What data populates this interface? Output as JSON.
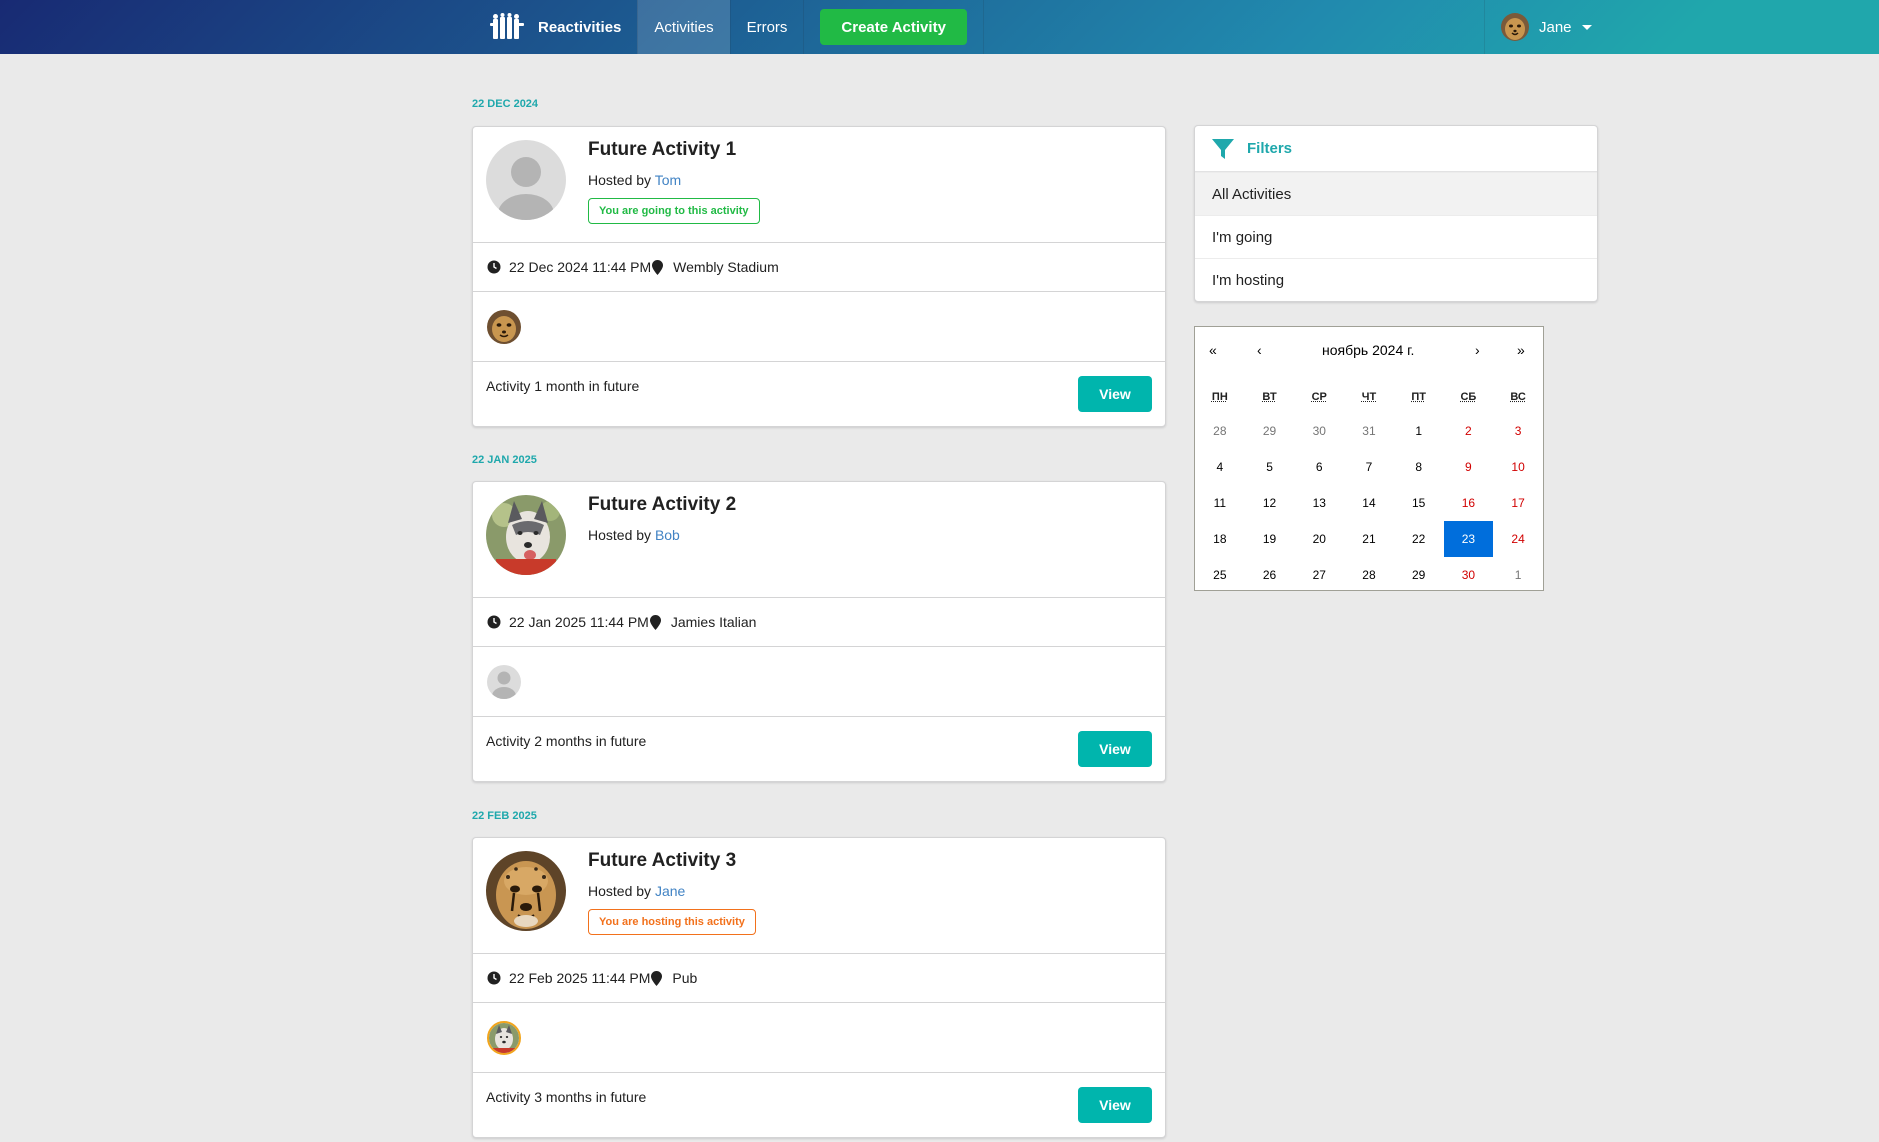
{
  "navbar": {
    "brand": "Reactivities",
    "activities": "Activities",
    "errors": "Errors",
    "create": "Create Activity",
    "user": "Jane"
  },
  "activities": [
    {
      "date_header": "22 DEC 2024",
      "title": "Future Activity 1",
      "hosted_prefix": "Hosted by",
      "host": "Tom",
      "badge": "You are going to this activity",
      "datetime": "22 Dec 2024 11:44 PM",
      "venue": "Wembly Stadium",
      "description": "Activity 1 month in future",
      "view": "View"
    },
    {
      "date_header": "22 JAN 2025",
      "title": "Future Activity 2",
      "hosted_prefix": "Hosted by",
      "host": "Bob",
      "badge": "",
      "datetime": "22 Jan 2025 11:44 PM",
      "venue": "Jamies Italian",
      "description": "Activity 2 months in future",
      "view": "View"
    },
    {
      "date_header": "22 FEB 2025",
      "title": "Future Activity 3",
      "hosted_prefix": "Hosted by",
      "host": "Jane",
      "badge": "You are hosting this activity",
      "datetime": "22 Feb 2025 11:44 PM",
      "venue": "Pub",
      "description": "Activity 3 months in future",
      "view": "View"
    }
  ],
  "filters": {
    "title": "Filters",
    "items": [
      "All Activities",
      "I'm going",
      "I'm hosting"
    ]
  },
  "calendar": {
    "prev2": "«",
    "prev": "‹",
    "label": "ноябрь 2024 г.",
    "next": "›",
    "next2": "»",
    "weekdays": [
      "ПН",
      "ВТ",
      "СР",
      "ЧТ",
      "ПТ",
      "СБ",
      "ВС"
    ],
    "weeks": [
      [
        "28",
        "29",
        "30",
        "31",
        "1",
        "2",
        "3"
      ],
      [
        "4",
        "5",
        "6",
        "7",
        "8",
        "9",
        "10"
      ],
      [
        "11",
        "12",
        "13",
        "14",
        "15",
        "16",
        "17"
      ],
      [
        "18",
        "19",
        "20",
        "21",
        "22",
        "23",
        "24"
      ],
      [
        "25",
        "26",
        "27",
        "28",
        "29",
        "30",
        "1"
      ]
    ],
    "selected": "23"
  },
  "colors": {
    "accent": "#1fa8ac",
    "view_button": "#00b5ad",
    "create_button": "#21ba45",
    "going": "#21ba45",
    "hosting": "#f2711c",
    "link": "#4183c4",
    "calendar_today": "#006edc",
    "weekend": "#d10000"
  }
}
